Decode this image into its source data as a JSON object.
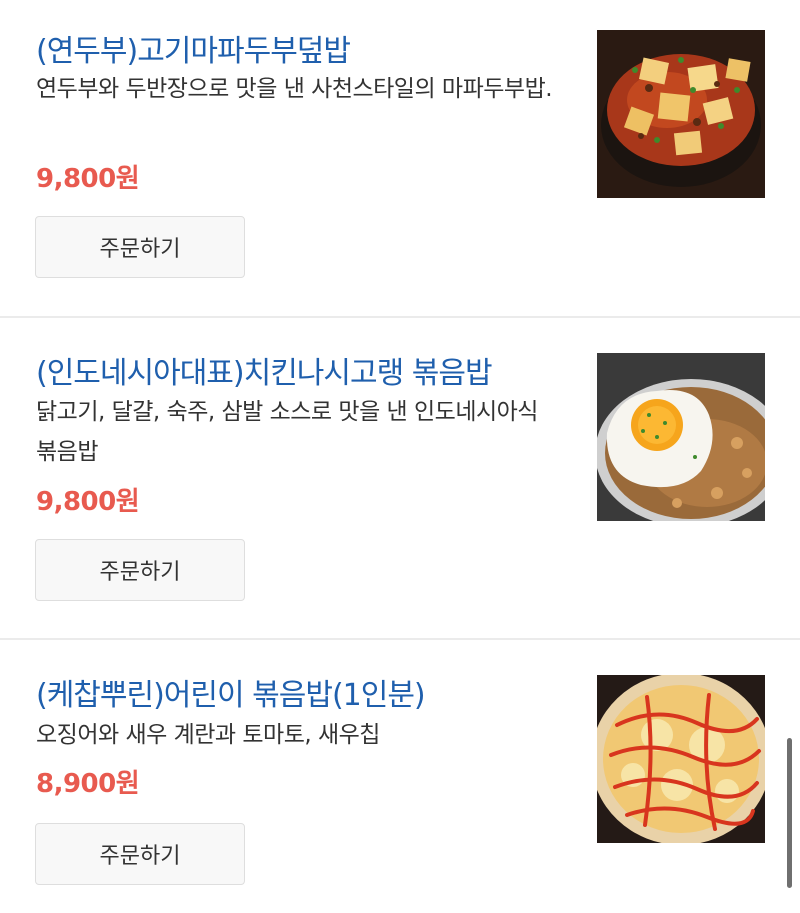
{
  "menu": {
    "items": [
      {
        "name": "(연두부)고기마파두부덮밥",
        "description": "연두부와 두반장으로 맛을 낸 사천스타일의 마파두부밥.",
        "price": "9,800원",
        "order_label": "주문하기",
        "image_icon": "mapo-tofu-rice-photo"
      },
      {
        "name": "(인도네시아대표)치킨나시고랭 볶음밥",
        "description": "닭고기, 달걀, 숙주, 삼발 소스로 맛을 낸 인도네시아식 볶음밥",
        "price": "9,800원",
        "order_label": "주문하기",
        "image_icon": "nasi-goreng-photo"
      },
      {
        "name": "(케찹뿌린)어린이 볶음밥(1인분)",
        "description": "오징어와 새우 계란과 토마토, 새우칩",
        "price": "8,900원",
        "order_label": "주문하기",
        "image_icon": "kids-fried-rice-photo"
      }
    ]
  },
  "colors": {
    "title": "#1f5fad",
    "price": "#e85a4f",
    "text": "#333333"
  }
}
